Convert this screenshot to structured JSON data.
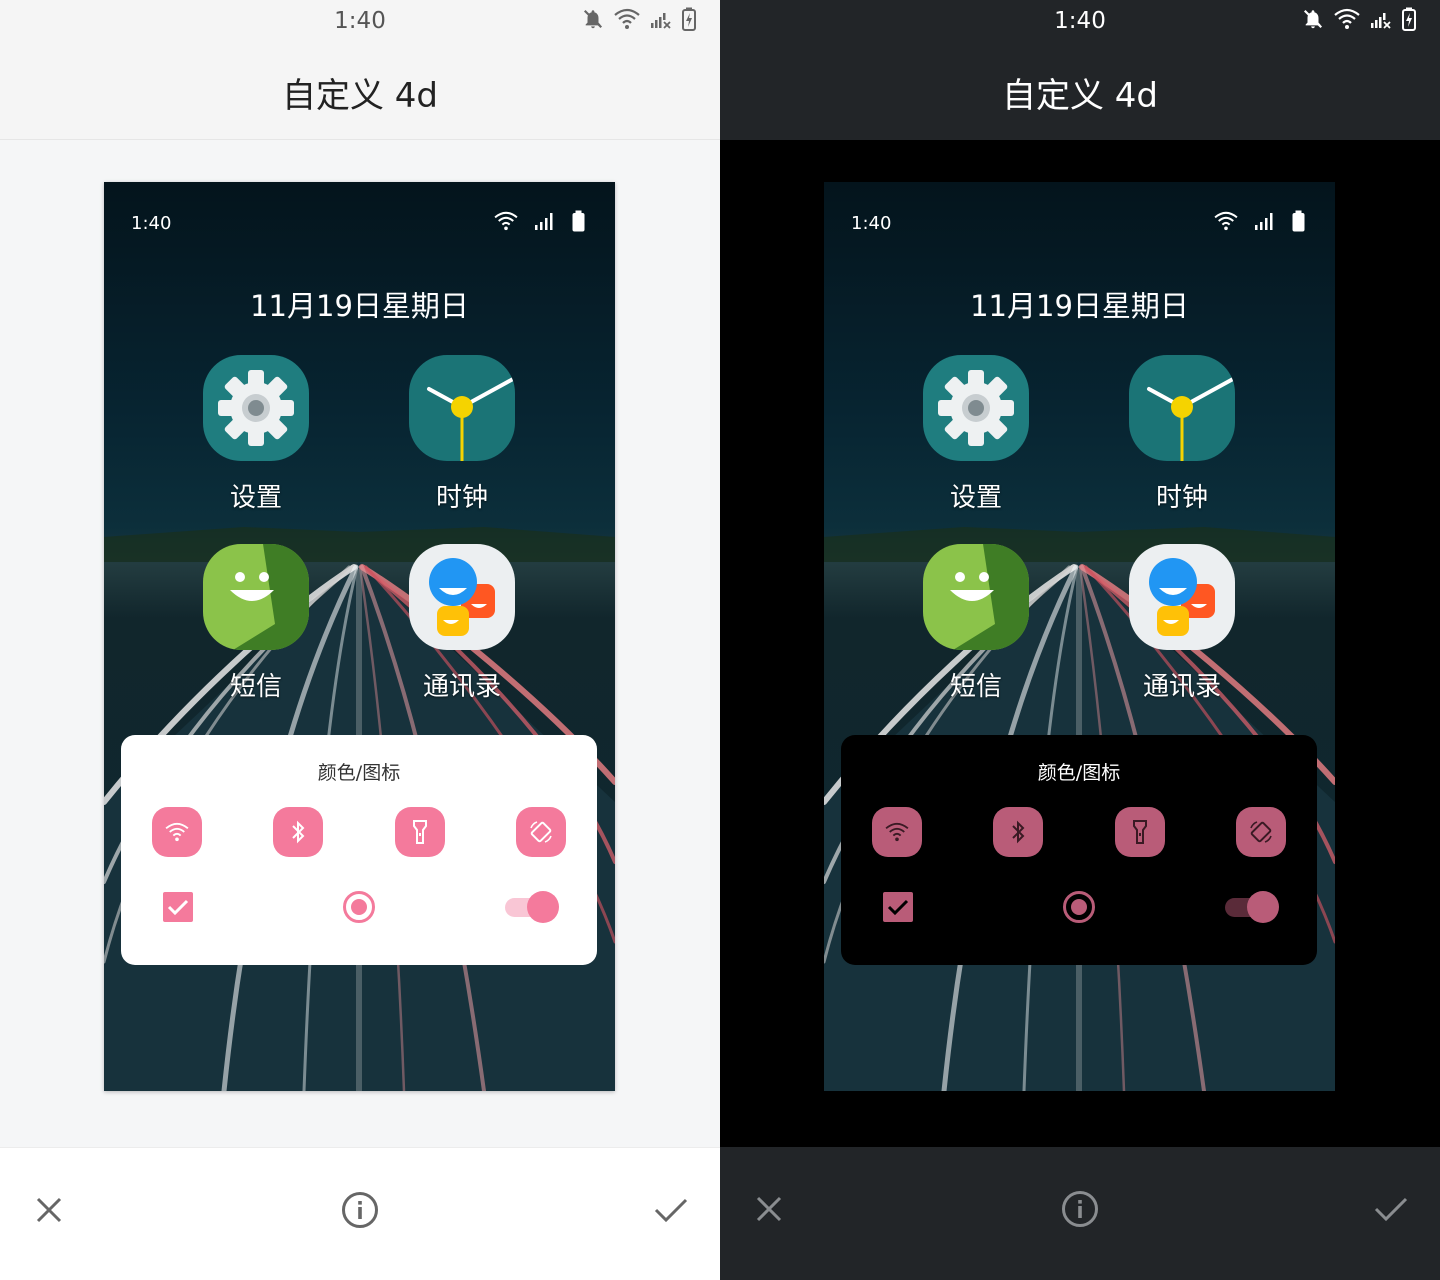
{
  "status_bar": {
    "time": "1:40"
  },
  "header": {
    "title": "自定义 4d"
  },
  "preview": {
    "time": "1:40",
    "date": "11月19日星期日",
    "apps": [
      {
        "label": "设置",
        "icon": "settings-gear-icon"
      },
      {
        "label": "时钟",
        "icon": "clock-icon"
      },
      {
        "label": "短信",
        "icon": "messages-icon"
      },
      {
        "label": "通讯录",
        "icon": "contacts-icon"
      }
    ],
    "card": {
      "title": "颜色/图标",
      "tiles": [
        "wifi-icon",
        "bluetooth-icon",
        "flashlight-icon",
        "auto-rotate-icon"
      ],
      "checkbox_checked": true,
      "radio_selected": true,
      "switch_on": true
    }
  },
  "bottom_bar": {
    "buttons": [
      "close-icon",
      "info-icon",
      "check-icon"
    ]
  },
  "colors": {
    "accent_light": "#f47a9c",
    "accent_dark": "#b95c78",
    "header_light": "#f5f5f5",
    "header_dark": "#222528"
  }
}
